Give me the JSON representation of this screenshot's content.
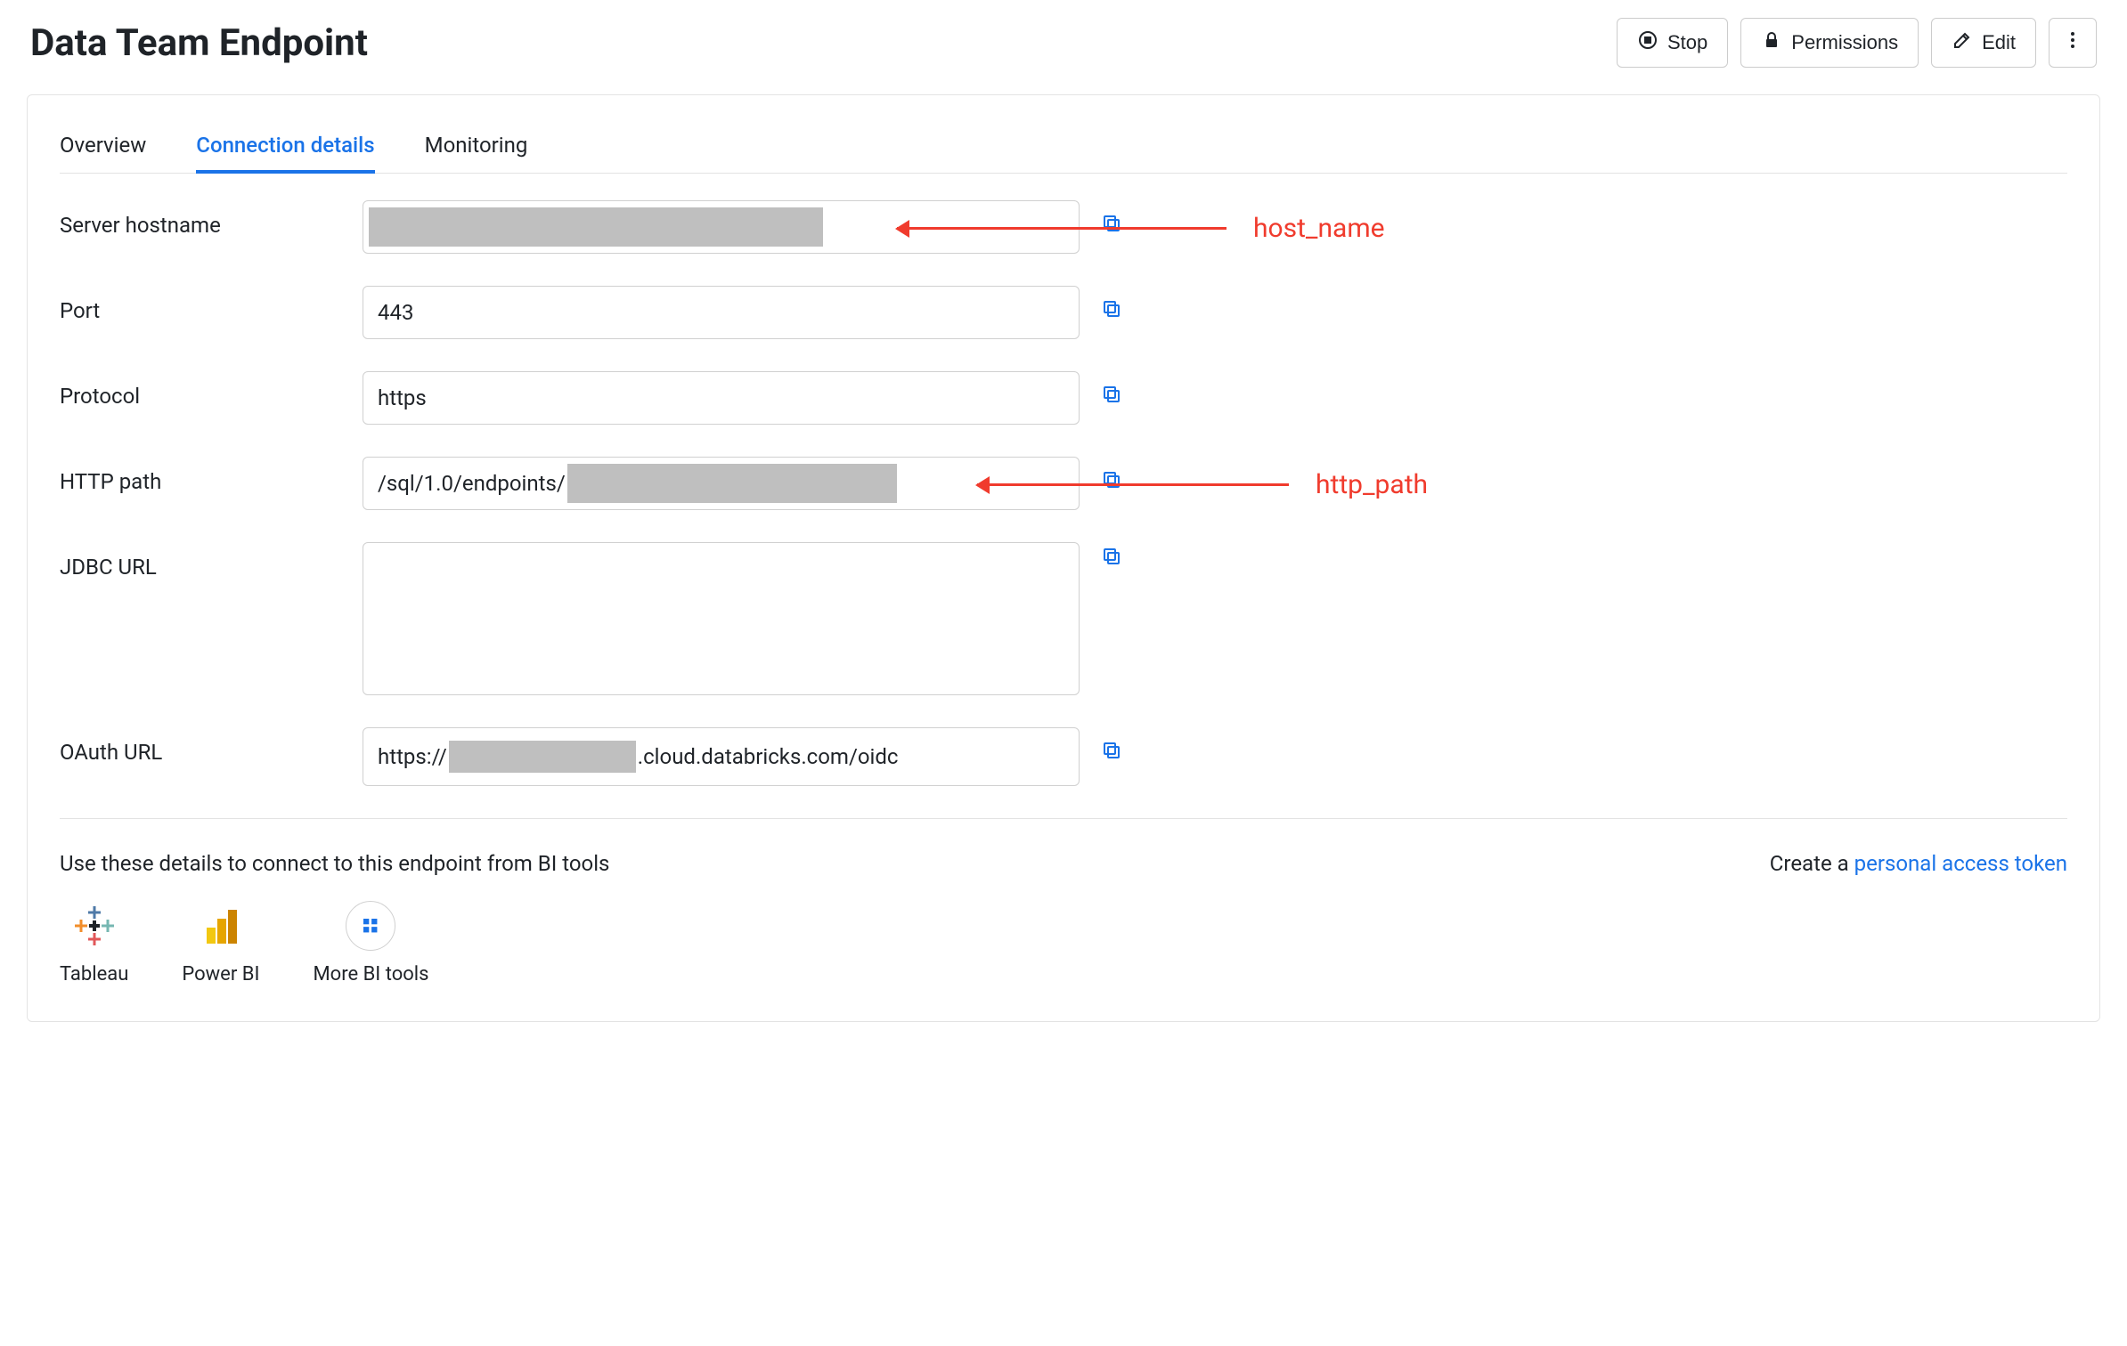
{
  "header": {
    "title": "Data Team Endpoint",
    "stop_label": "Stop",
    "permissions_label": "Permissions",
    "edit_label": "Edit"
  },
  "tabs": {
    "overview": "Overview",
    "connection_details": "Connection details",
    "monitoring": "Monitoring",
    "active": "connection_details"
  },
  "fields": {
    "server_hostname": {
      "label": "Server hostname",
      "value": ""
    },
    "port": {
      "label": "Port",
      "value": "443"
    },
    "protocol": {
      "label": "Protocol",
      "value": "https"
    },
    "http_path": {
      "label": "HTTP path",
      "value_prefix": "/sql/1.0/endpoints/",
      "value_suffix_redacted": true
    },
    "jdbc_url": {
      "label": "JDBC URL",
      "value": ""
    },
    "oauth_url": {
      "label": "OAuth URL",
      "prefix": "https://",
      "suffix": ".cloud.databricks.com/oidc"
    }
  },
  "annotations": {
    "host_name": "host_name",
    "http_path": "http_path"
  },
  "footer": {
    "hint": "Use these details to connect to this endpoint from BI tools",
    "create_prefix": "Create a ",
    "create_link": "personal access token"
  },
  "bi_tools": {
    "tableau": "Tableau",
    "powerbi": "Power BI",
    "more": "More BI tools"
  },
  "colors": {
    "accent": "#1a73e8",
    "annotation": "#f03b2d",
    "redact": "#bfbfbf"
  }
}
